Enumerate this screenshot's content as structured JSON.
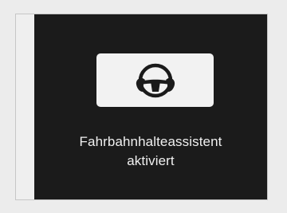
{
  "display": {
    "icon": "lane-keeping-assist-steering-wheel-icon",
    "message_line1": "Fahrbahnhalteassistent",
    "message_line2": "aktiviert"
  },
  "colors": {
    "screen_background": "#1b1b1b",
    "icon_card": "#f2f2f2",
    "icon": "#1b1b1b",
    "text": "#f0f0f0"
  }
}
